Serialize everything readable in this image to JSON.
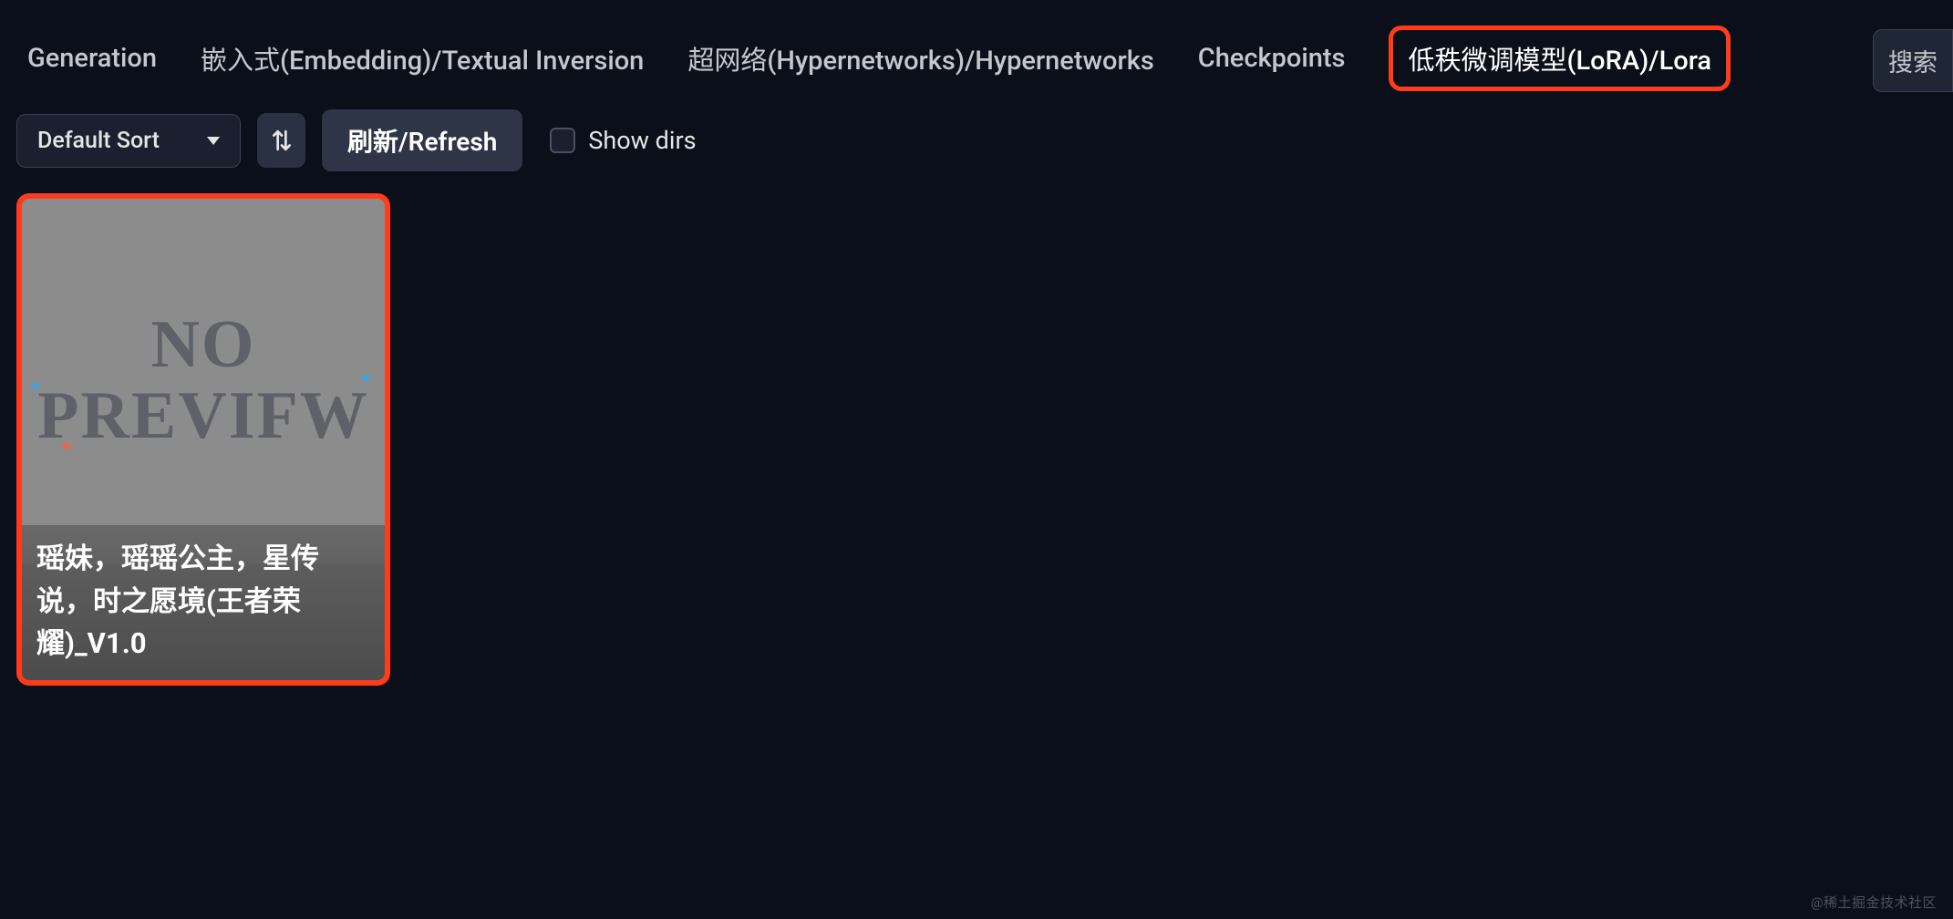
{
  "tabs": {
    "generation": "Generation",
    "embedding": "嵌入式(Embedding)/Textual Inversion",
    "hypernetworks": "超网络(Hypernetworks)/Hypernetworks",
    "checkpoints": "Checkpoints",
    "lora": "低秩微调模型(LoRA)/Lora"
  },
  "search_label": "搜索",
  "toolbar": {
    "sort_label": "Default Sort",
    "refresh_label": "刷新/Refresh",
    "show_dirs_label": "Show dirs"
  },
  "card": {
    "no_preview_line1": "NO",
    "no_preview_line2": "PREVIFW",
    "title": "瑶妹，瑶瑶公主，星传说，时之愿境(王者荣耀)_V1.0"
  },
  "watermark": "@稀土掘金技术社区"
}
